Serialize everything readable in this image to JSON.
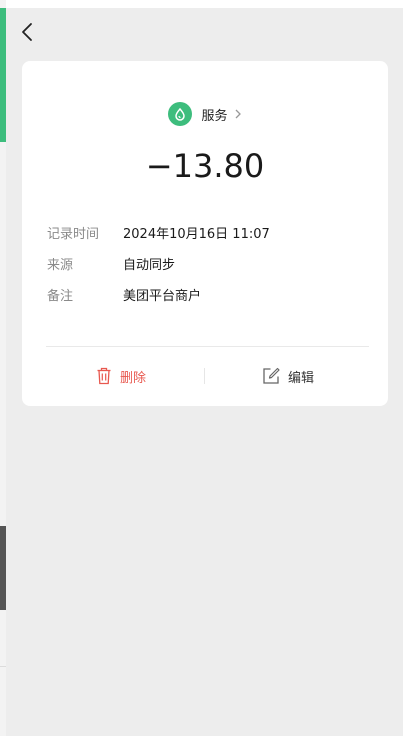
{
  "category": {
    "label": "服务",
    "icon": "service-drop-icon"
  },
  "amount": "−13.80",
  "details": [
    {
      "key": "记录时间",
      "value": "2024年10月16日 11:07"
    },
    {
      "key": "来源",
      "value": "自动同步"
    },
    {
      "key": "备注",
      "value": "美团平台商户"
    }
  ],
  "actions": {
    "delete_label": "删除",
    "edit_label": "编辑"
  },
  "colors": {
    "accent": "#3dbd7d",
    "danger": "#e8584f",
    "page_bg": "#ededed"
  }
}
